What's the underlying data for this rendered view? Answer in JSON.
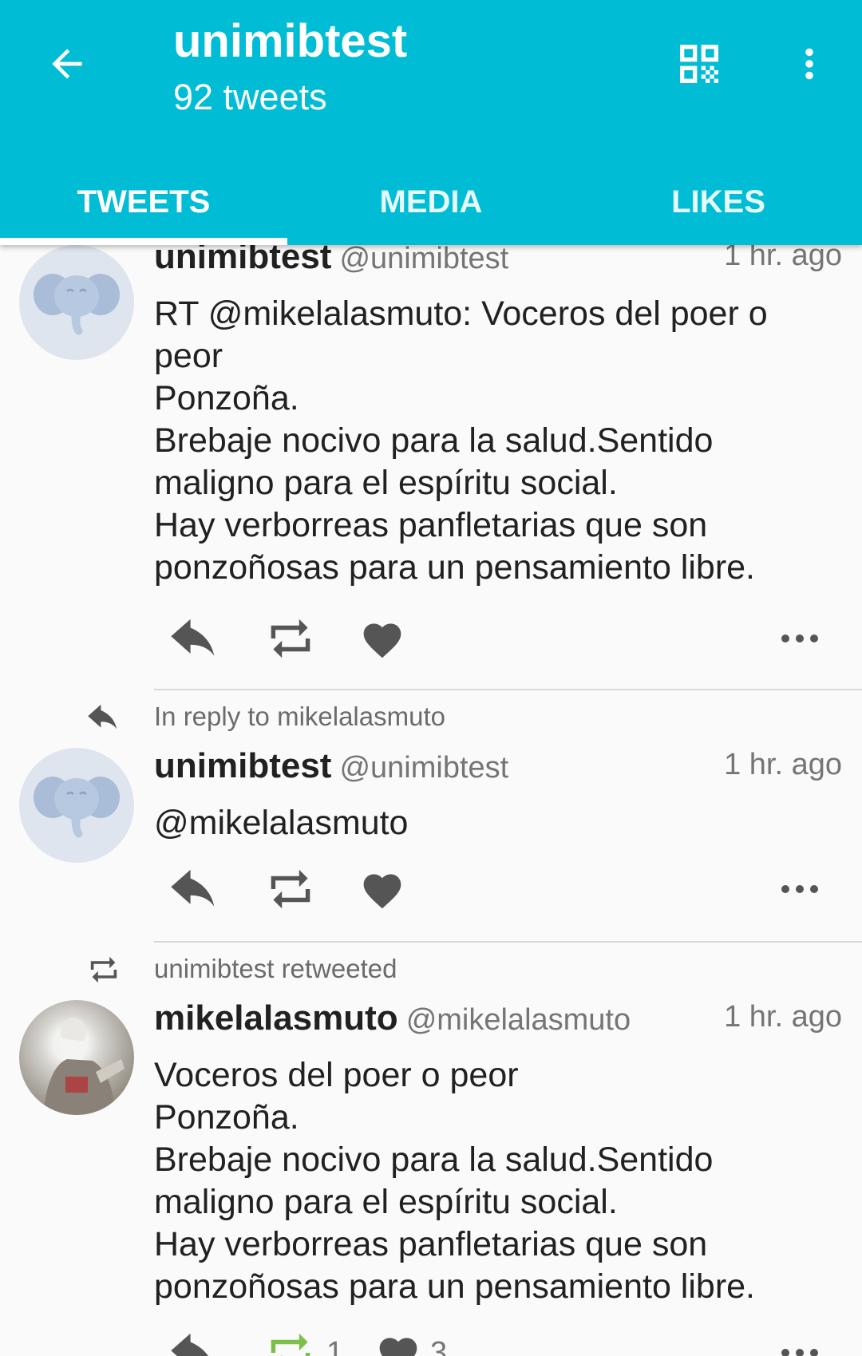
{
  "appbar": {
    "title": "unimibtest",
    "subtitle": "92 tweets",
    "back_icon": "arrow-back-icon",
    "qr_icon": "qr-code-icon",
    "overflow_icon": "more-vert-icon",
    "color": "#00bcd4"
  },
  "tabs": [
    {
      "label": "TWEETS",
      "selected": true
    },
    {
      "label": "MEDIA",
      "selected": false
    },
    {
      "label": "LIKES",
      "selected": false
    }
  ],
  "tweets": [
    {
      "author": "unimibtest",
      "handle": "@unimibtest",
      "time": "1 hr. ago",
      "avatar": "elephant-avatar",
      "lines": [
        "RT @mikelalasmuto: Voceros del poer o",
        "peor",
        "Ponzoña.",
        "Brebaje nocivo para la salud.Sentido",
        "maligno para el espíritu social.",
        "Hay verborreas panfletarias que son",
        "ponzoñosas para un pensamiento libre."
      ]
    },
    {
      "context": "In reply to mikelalasmuto",
      "context_icon": "reply-icon",
      "author": "unimibtest",
      "handle": "@unimibtest",
      "time": "1 hr. ago",
      "avatar": "elephant-avatar",
      "lines": [
        "@mikelalasmuto"
      ]
    },
    {
      "context": "unimibtest retweeted",
      "context_icon": "retweet-icon",
      "author": "mikelalasmuto",
      "handle": "@mikelalasmuto",
      "time": "1 hr. ago",
      "avatar": "photo-avatar",
      "lines": [
        "Voceros del poer o peor",
        "Ponzoña.",
        "Brebaje nocivo para la salud.Sentido",
        "maligno para el espíritu social.",
        "Hay verborreas panfletarias que son",
        "ponzoñosas para un pensamiento libre."
      ],
      "retweet_count": "1",
      "like_count": "3",
      "retweet_color": "#7cc04b"
    }
  ]
}
